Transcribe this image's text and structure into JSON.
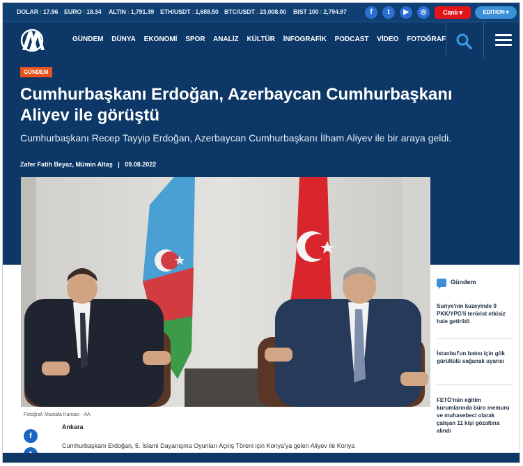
{
  "ticker": [
    {
      "label": "DOLAR",
      "dir": "up",
      "value": "17.96"
    },
    {
      "label": "EURO",
      "dir": "up",
      "value": "18.34"
    },
    {
      "label": "ALTIN",
      "dir": "dn",
      "value": "1,791.39"
    },
    {
      "label": "ETH/USDT",
      "dir": "dn",
      "value": "1,688.50"
    },
    {
      "label": "BTC/USDT",
      "dir": "dn",
      "value": "23,008.00"
    },
    {
      "label": "BIST 100",
      "dir": "up",
      "value": "2,794.97"
    }
  ],
  "header": {
    "live_label": "Canlı",
    "edition_label": "EDITION",
    "nav": [
      "GÜNDEM",
      "DÜNYA",
      "EKONOMİ",
      "SPOR",
      "ANALİZ",
      "KÜLTÜR",
      "İNFOGRAFİK",
      "PODCAST",
      "VİDEO",
      "FOTOĞRAF"
    ]
  },
  "article": {
    "category": "GÜNDEM",
    "title": "Cumhurbaşkanı Erdoğan, Azerbaycan Cumhurbaşkanı Aliyev ile görüştü",
    "lead": "Cumhurbaşkanı Recep Tayyip Erdoğan, Azerbaycan Cumhurbaşkanı İlham Aliyev ile bir araya geldi.",
    "authors": "Zafer Fatih Beyaz, Mümin Altaş",
    "date": "09.08.2022",
    "photo_credit": "Fotoğraf: Mustafa Kamacı - AA",
    "location": "Ankara",
    "body_start": "Cumhurbaşkanı Erdoğan, 5. İslami Dayanışma Oyunları Açılış Töreni için Konya'ya gelen Aliyev ile Konya"
  },
  "sidebar": {
    "category": "Gündem",
    "items": [
      "Suriye'nin kuzeyinde 9 PKK/YPG'li terörist etkisiz hale getirildi",
      "İstanbul'un batısı için gök gürültülü sağanak uyarısı",
      "FETÖ'nün eğitim kurumlarında büro memuru ve muhasebeci olarak çalışan 11 kişi gözaltına alındı"
    ]
  },
  "icons": [
    "facebook-icon",
    "twitter-icon",
    "youtube-icon",
    "instagram-icon",
    "search-icon",
    "menu-icon",
    "aa-logo"
  ],
  "colors": {
    "navy": "#0c3766",
    "ticker": "#0f3f73",
    "badge": "#e8521c",
    "live": "#e3151a",
    "up": "#3fca5d",
    "down": "#e14a4a"
  }
}
